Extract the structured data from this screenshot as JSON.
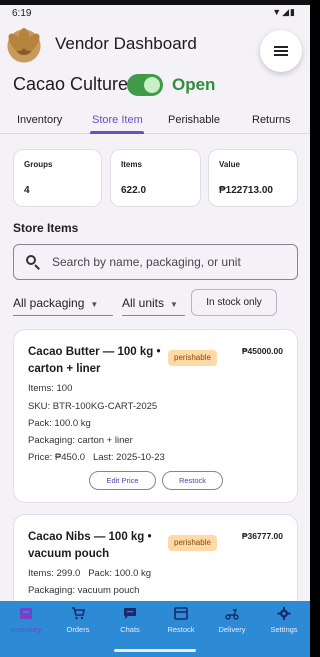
{
  "status_bar": {
    "time": "6:19",
    "icons": "▼◢▮"
  },
  "header": {
    "title": "Vendor Dashboard",
    "menu_icon": "menu-icon"
  },
  "store": {
    "name": "Cacao Culture",
    "status": "Open",
    "open_toggle": true
  },
  "tabs": [
    {
      "label": "Inventory",
      "active": false
    },
    {
      "label": "Store Item",
      "active": true
    },
    {
      "label": "Perishable",
      "active": false
    },
    {
      "label": "Returns",
      "active": false
    }
  ],
  "stats": [
    {
      "label": "Groups",
      "value": "4"
    },
    {
      "label": "Items",
      "value": "622.0"
    },
    {
      "label": "Value",
      "value": "₱122713.00"
    }
  ],
  "section": {
    "title": "Store Items"
  },
  "search": {
    "placeholder": "Search by name, packaging, or unit"
  },
  "filters": {
    "packaging": "All packaging",
    "units": "All units",
    "in_stock_chip": "In stock only"
  },
  "items": [
    {
      "name": "Cacao Butter — 100 kg • carton + liner",
      "badge": "perishable",
      "total": "₱45000.00",
      "items_line": "Items: 100",
      "sku_line": "SKU: BTR-100KG-CART-2025",
      "pack_line": "Pack: 100.0 kg",
      "packaging_line": "Packaging: carton + liner",
      "price_line": "Price: ₱450.0   Last: 2025-10-23",
      "edit_price": "Edit Price",
      "restock": "Restock"
    },
    {
      "name": "Cacao Nibs — 100 kg • vacuum pouch",
      "badge": "perishable",
      "total": "₱36777.00",
      "items_line": "Items: 299.0   Pack: 100.0 kg",
      "packaging_line": "Packaging: vacuum pouch"
    }
  ],
  "bottom_nav": [
    {
      "label": "Inventory",
      "icon": "inventory-icon",
      "active": true
    },
    {
      "label": "Orders",
      "icon": "cart-icon",
      "active": false
    },
    {
      "label": "Chats",
      "icon": "chat-icon",
      "active": false
    },
    {
      "label": "Restock",
      "icon": "store-icon",
      "active": false
    },
    {
      "label": "Delivery",
      "icon": "scooter-icon",
      "active": false
    },
    {
      "label": "Settings",
      "icon": "gear-icon",
      "active": false
    }
  ],
  "colors": {
    "accent": "#6a4fc1",
    "open_green": "#2f8f3a",
    "nav_bg": "#2d8bd6",
    "badge_bg": "#ffd9a8",
    "nav_active": "#7a3fc7"
  }
}
